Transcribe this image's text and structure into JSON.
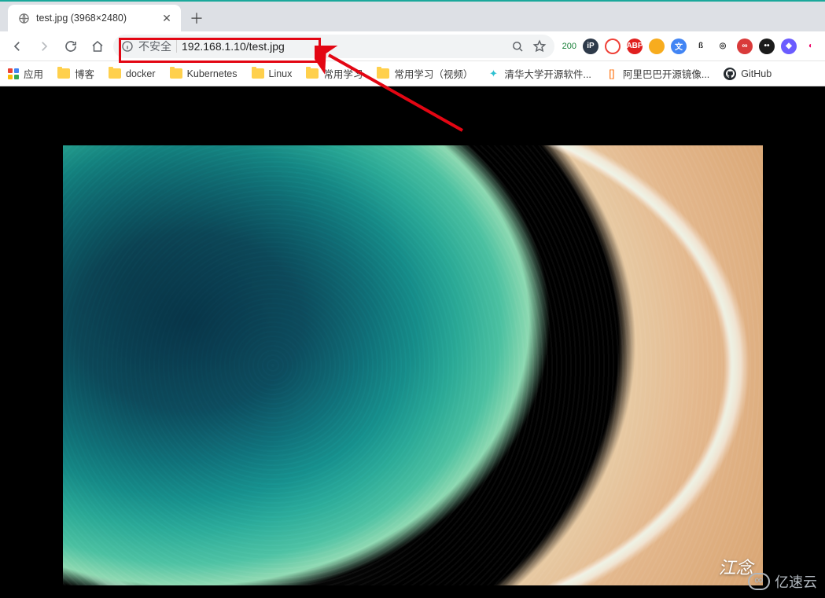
{
  "tab": {
    "title": "test.jpg (3968×2480)",
    "favicon": "globe-icon"
  },
  "toolbar": {
    "insecure_label": "不安全",
    "url": "192.168.1.10/test.jpg",
    "zoom_badge": "200"
  },
  "bookmarks": {
    "apps": "应用",
    "items": [
      {
        "label": "博客",
        "type": "folder"
      },
      {
        "label": "docker",
        "type": "folder"
      },
      {
        "label": "Kubernetes",
        "type": "folder"
      },
      {
        "label": "Linux",
        "type": "folder"
      },
      {
        "label": "常用学习",
        "type": "folder"
      },
      {
        "label": "常用学习（视频）",
        "type": "folder"
      },
      {
        "label": "清华大学开源软件...",
        "type": "link",
        "icon": "tsinghua"
      },
      {
        "label": "阿里巴巴开源镜像...",
        "type": "link",
        "icon": "alibaba"
      },
      {
        "label": "GitHub",
        "type": "link",
        "icon": "github"
      }
    ]
  },
  "image": {
    "caption_partial": "江念"
  },
  "extensions": [
    {
      "name": "ip-ext",
      "bg": "#2e3a4a",
      "text": "iP"
    },
    {
      "name": "circle-red-ext",
      "bg": "#ffffff",
      "text": "",
      "ring": "#ef4037"
    },
    {
      "name": "abp-ext",
      "bg": "#e0201f",
      "text": "ABP"
    },
    {
      "name": "globe-ext",
      "bg": "#f7ac1e",
      "text": ""
    },
    {
      "name": "translate-ext",
      "bg": "#4285f4",
      "text": "文"
    },
    {
      "name": "beta-ext",
      "bg": "#ffffff",
      "text": "ß",
      "fg": "#333"
    },
    {
      "name": "ring-ext",
      "bg": "#ffffff",
      "text": "◎",
      "fg": "#333"
    },
    {
      "name": "infinity-ext",
      "bg": "#d93a3a",
      "text": "∞"
    },
    {
      "name": "eyes-ext",
      "bg": "#1b1b1b",
      "text": "••"
    },
    {
      "name": "diamond-ext",
      "bg": "#6b5cff",
      "text": "◆"
    },
    {
      "name": "colorwheel-ext",
      "bg": "#ffffff",
      "text": "◐",
      "fg": "#e06"
    }
  ],
  "watermark": {
    "text": "亿速云"
  }
}
